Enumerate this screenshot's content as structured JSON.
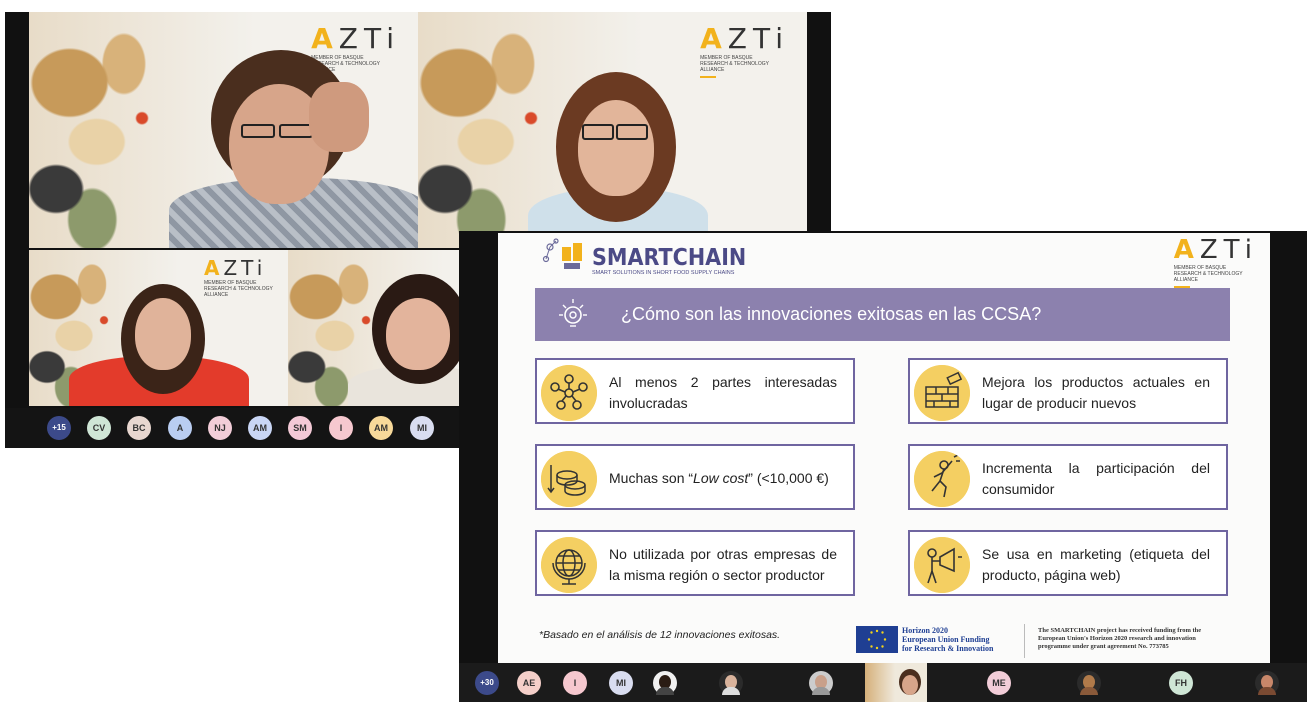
{
  "gallery": {
    "brand": {
      "logo_word": "ZTi",
      "logo_initial": "A",
      "tagline": "MEMBER OF BASQUE RESEARCH & TECHNOLOGY ALLIANCE"
    },
    "participants_strip": {
      "overflow_badge": "+15",
      "avatars": [
        {
          "initials": "CV",
          "color": "#cfe6d6"
        },
        {
          "initials": "BC",
          "color": "#e8d7d0"
        },
        {
          "initials": "A",
          "color": "#b9cdf1"
        },
        {
          "initials": "NJ",
          "color": "#f2cdd8"
        },
        {
          "initials": "AM",
          "color": "#c9d6f5"
        },
        {
          "initials": "SM",
          "color": "#f3c9d6"
        },
        {
          "initials": "I",
          "color": "#f6c8cf"
        },
        {
          "initials": "AM",
          "color": "#f7d99a"
        },
        {
          "initials": "MI",
          "color": "#d9ddf0"
        }
      ]
    }
  },
  "presentation": {
    "slide": {
      "project_logo_title": "SMARTCHAIN",
      "project_logo_subtitle": "SMART SOLUTIONS IN SHORT FOOD SUPPLY CHAINS",
      "question": "¿Cómo son las innovaciones exitosas en las CCSA?",
      "cards": [
        {
          "icon": "network-icon",
          "text": "Al menos 2 partes interesadas involucradas"
        },
        {
          "icon": "brick-wall-icon",
          "text": "Mejora los productos actuales en lugar de producir nuevos"
        },
        {
          "icon": "coins-icon",
          "text_before": "Muchas son “",
          "text_italic": "Low cost",
          "text_after": "” (<10,000 €)"
        },
        {
          "icon": "climbing-person-icon",
          "text": "Incrementa la participación del consumidor"
        },
        {
          "icon": "globe-icon",
          "text": "No utilizada por otras empresas de la misma región o sector productor"
        },
        {
          "icon": "megaphone-icon",
          "text": "Se usa en marketing (etiqueta del producto, página web)"
        }
      ],
      "footnote": "*Basado en el análisis de 12 innovaciones exitosas.",
      "eu_label_1": "Horizon 2020",
      "eu_label_2": "European Union Funding",
      "eu_label_3": "for Research & Innovation",
      "funding_notice": "The SMARTCHAIN project has received funding from the European Union's Horizon 2020 research and innovation programme under grant agreement No. 773785"
    },
    "participants_strip": {
      "overflow_badge": "+30",
      "avatars": [
        {
          "initials": "AE",
          "color": "#f4cfc9"
        },
        {
          "initials": "I",
          "color": "#f6c8cf"
        },
        {
          "initials": "MI",
          "color": "#d9ddf0"
        },
        {
          "initials": "ME",
          "color": "#f2cdd8"
        },
        {
          "initials": "FH",
          "color": "#cfe6d6"
        }
      ]
    }
  }
}
